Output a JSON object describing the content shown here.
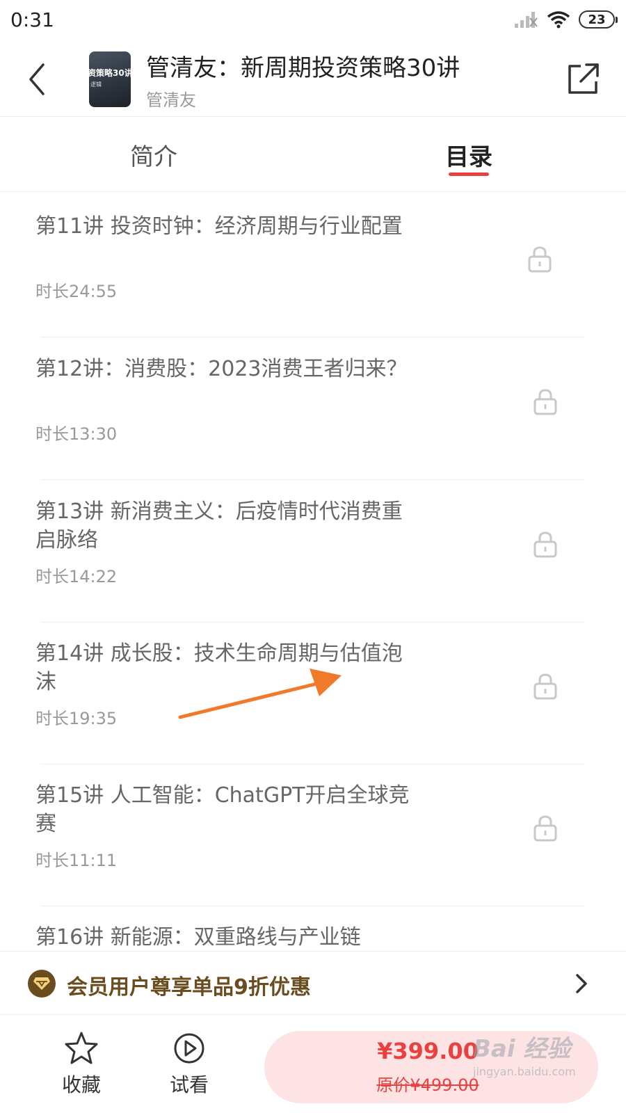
{
  "status_bar": {
    "time": "0:31",
    "battery": "23"
  },
  "header": {
    "cover_text": "资策略30讲",
    "cover_sub": "逻辑",
    "title": "管清友：新周期投资策略30讲",
    "author": "管清友"
  },
  "tabs": [
    {
      "label": "简介",
      "active": false
    },
    {
      "label": "目录",
      "active": true
    }
  ],
  "lessons": [
    {
      "title": "第11讲 投资时钟：经济周期与行业配置",
      "duration": "时长24:55",
      "locked": true
    },
    {
      "title": "第12讲：消费股：2023消费王者归来？",
      "duration": "时长13:30",
      "locked": true
    },
    {
      "title": "第13讲 新消费主义：后疫情时代消费重启脉络",
      "duration": "时长14:22",
      "locked": true
    },
    {
      "title": "第14讲  成长股：技术生命周期与估值泡沫",
      "duration": "时长19:35",
      "locked": true
    },
    {
      "title": "第15讲 人工智能：ChatGPT开启全球竞赛",
      "duration": "时长11:11",
      "locked": true
    },
    {
      "title": "第16讲 新能源：双重路线与产业链",
      "duration": "",
      "locked": true
    }
  ],
  "member_banner": {
    "text": "会员用户尊享单品9折优惠"
  },
  "bottom": {
    "favorite_label": "收藏",
    "trial_label": "试看",
    "price": "¥399.00",
    "original_price": "原价¥499.00"
  },
  "watermark": {
    "main": "Bai 经验",
    "url": "jingyan.baidu.com"
  },
  "colors": {
    "accent": "#e8413f",
    "member_gold": "#6b4c1e",
    "buy_bg": "#fde3e3",
    "arrow": "#f07a2a"
  }
}
